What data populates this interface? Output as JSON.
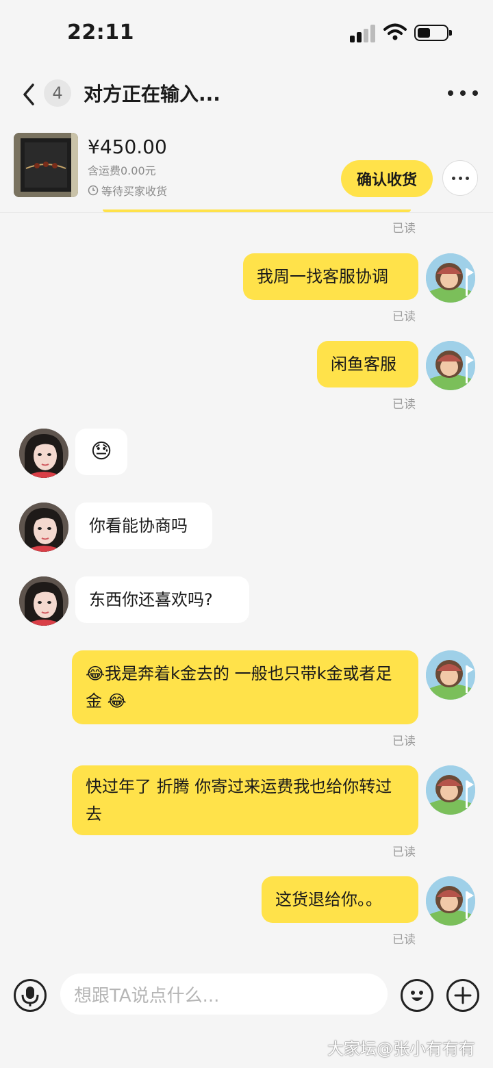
{
  "status_bar": {
    "time": "22:11"
  },
  "header": {
    "back_icon": "chevron-left-icon",
    "unread_count": "4",
    "title": "对方正在输入...",
    "more_icon": "more-horizontal-icon"
  },
  "product": {
    "price": "¥450.00",
    "shipping": "含运费0.00元",
    "status": "等待买家收货",
    "confirm_label": "确认收货"
  },
  "colors": {
    "accent": "#ffe24a",
    "background": "#f5f5f5",
    "read_text": "#9b9b9b"
  },
  "messages": [
    {
      "side": "me",
      "text": "我周一找客服协调",
      "read": "已读"
    },
    {
      "side": "me",
      "text": "闲鱼客服",
      "read": "已读"
    },
    {
      "side": "them",
      "text": "😓"
    },
    {
      "side": "them",
      "text": "你看能协商吗"
    },
    {
      "side": "them",
      "text": "东西你还喜欢吗?"
    },
    {
      "side": "me",
      "text": "😂我是奔着k金去的 一般也只带k金或者足金 😂",
      "read": "已读"
    },
    {
      "side": "me",
      "text": "快过年了 折腾 你寄过来运费我也给你转过去",
      "read": "已读"
    },
    {
      "side": "me",
      "text": "这货退给你。。",
      "read": "已读"
    }
  ],
  "top_read": "已读",
  "input": {
    "placeholder": "想跟TA说点什么..."
  },
  "watermark": "大家坛@张小有有有"
}
